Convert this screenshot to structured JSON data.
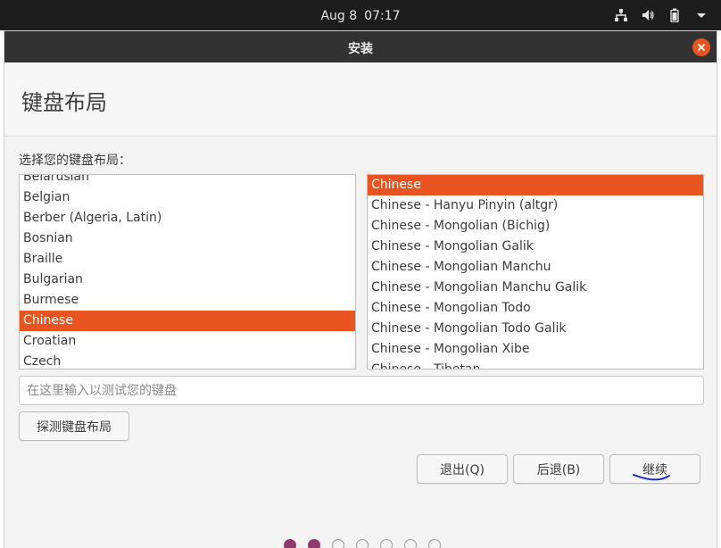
{
  "topbar": {
    "date": "Aug 8",
    "time": "07:17",
    "icons": [
      "network-icon",
      "volume-icon",
      "battery-icon",
      "system-menu-arrow-icon"
    ]
  },
  "window": {
    "title": "安装",
    "close_icon": "close-icon"
  },
  "page": {
    "title": "键盘布局",
    "prompt": "选择您的键盘布局："
  },
  "layouts": {
    "items": [
      "Belarusian",
      "Belgian",
      "Berber (Algeria, Latin)",
      "Bosnian",
      "Braille",
      "Bulgarian",
      "Burmese",
      "Chinese",
      "Croatian",
      "Czech"
    ],
    "selected": "Chinese"
  },
  "variants": {
    "items": [
      "Chinese",
      "Chinese - Hanyu Pinyin (altgr)",
      "Chinese - Mongolian (Bichig)",
      "Chinese - Mongolian Galik",
      "Chinese - Mongolian Manchu",
      "Chinese - Mongolian Manchu Galik",
      "Chinese - Mongolian Todo",
      "Chinese - Mongolian Todo Galik",
      "Chinese - Mongolian Xibe",
      "Chinese - Tibetan"
    ],
    "selected": "Chinese"
  },
  "test_input": {
    "placeholder": "在这里输入以测试您的键盘",
    "value": ""
  },
  "buttons": {
    "detect": "探测键盘布局",
    "quit": "退出(Q)",
    "back": "后退(B)",
    "continue": "继续"
  },
  "progress": {
    "current_step": 2,
    "total_steps": 7
  },
  "colors": {
    "accent": "#e95420",
    "progress_filled": "#8e3a6e",
    "annotation": "#1a33c8"
  }
}
